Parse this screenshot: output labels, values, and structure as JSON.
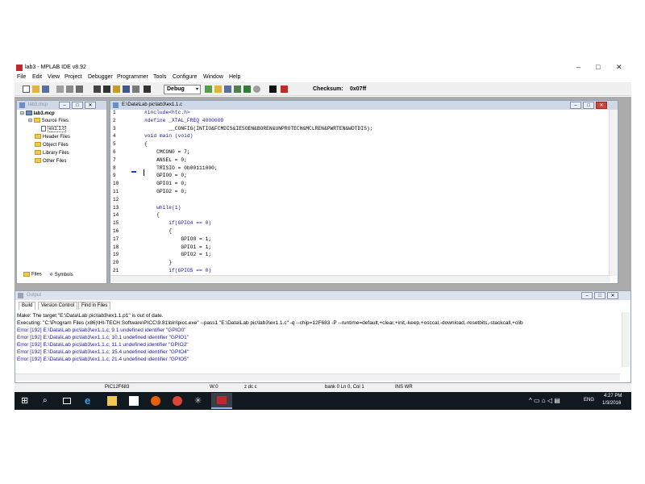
{
  "window": {
    "title": "lab3 - MPLAB IDE v8.92",
    "controls": [
      "–",
      "□",
      "✕"
    ]
  },
  "menu": [
    "File",
    "Edit",
    "View",
    "Project",
    "Debugger",
    "Programmer",
    "Tools",
    "Configure",
    "Window",
    "Help"
  ],
  "toolbar": {
    "config_select": "Debug",
    "checksum_label": "Checksum:",
    "checksum_value": "0x07ff"
  },
  "project_window": {
    "title": "lab3.mcp",
    "tree": [
      {
        "label": "lab3.mcp",
        "bold": true,
        "kind": "project"
      },
      {
        "label": "Source Files",
        "kind": "folder"
      },
      {
        "label": "ex1.1.c",
        "kind": "file"
      },
      {
        "label": "Header Files",
        "kind": "folder"
      },
      {
        "label": "Object Files",
        "kind": "folder"
      },
      {
        "label": "Library Files",
        "kind": "folder"
      },
      {
        "label": "Other Files",
        "kind": "folder"
      }
    ],
    "tabs": [
      "Files",
      "Symbols"
    ]
  },
  "editor": {
    "title": "E:\\Data\\Lab pic\\lab3\\ex1.1.c",
    "line_numbers": [
      "1",
      "2",
      "3",
      "4",
      "5",
      "6",
      "7",
      "8",
      "9",
      "10",
      "11",
      "12",
      "13",
      "14",
      "15",
      "16",
      "17",
      "18",
      "19",
      "20",
      "21"
    ],
    "lines": [
      "#include<htc.h>",
      "#define _XTAL_FREQ 4000000",
      "        __CONFIG(INTIO&FCMDIS&IESOEN&BOREN&UNPROTECH&MCLREN&PWRTEN&WDTDIS);",
      "void main (void)",
      "{",
      "    CMCON0 = 7;",
      "    ANSEL = 0;",
      "    TRISIO = 0b00111000;",
      "    GPIO0 = 0;",
      "    GPIO1 = 0;",
      "    GPIO2 = 0;",
      "",
      "    while(1)",
      "    {",
      "        if(GPIO4 == 0)",
      "        {",
      "            GPIO0 = 1;",
      "            GPIO1 = 1;",
      "            GPIO2 = 1;",
      "        }",
      "        if(GPIO5 == 0)"
    ]
  },
  "output_window": {
    "title": "Output",
    "tabs": [
      "Build",
      "Version Control",
      "Find in Files"
    ],
    "lines": [
      {
        "text": "Make: The target \"E:\\Data\\Lab pic\\lab3\\ex1.1.p1\" is out of date.",
        "error": false
      },
      {
        "text": "Executing: \"C:\\Program Files (x86)\\HI-TECH Software\\PICC\\9.81\\bin\\picc.exe\" --pass1 \"E:\\Data\\Lab pic\\lab3\\ex1.1.c\" -q --chip=12F683 -P --runtime=default,+clear,+init,-keep,+osccal,-download,-resetbits,-stackcall,+clib",
        "error": false
      },
      {
        "text": "Error   [192] E:\\Data\\Lab pic\\lab3\\ex1.1.c; 9.1 undefined identifier \"GPIO0\"",
        "error": true
      },
      {
        "text": "Error   [192] E:\\Data\\Lab pic\\lab3\\ex1.1.c; 10.1 undefined identifier \"GPIO1\"",
        "error": true
      },
      {
        "text": "Error   [192] E:\\Data\\Lab pic\\lab3\\ex1.1.c; 11.1 undefined identifier \"GPIO2\"",
        "error": true
      },
      {
        "text": "Error   [192] E:\\Data\\Lab pic\\lab3\\ex1.1.c; 15.4 undefined identifier \"GPIO4\"",
        "error": true
      },
      {
        "text": "Error   [192] E:\\Data\\Lab pic\\lab3\\ex1.1.c; 21.4 undefined identifier \"GPIO5\"",
        "error": true
      }
    ]
  },
  "statusbar": {
    "device": "PIC12F683",
    "w": "W:0",
    "flags": "z dc c",
    "position": "bank 0   Ln 0, Col 1",
    "mode": "INS   WR"
  },
  "taskbar": {
    "tray_lang": "ENG",
    "time": "4:27 PM",
    "date": "1/3/2016"
  },
  "colors": {
    "error_text": "#1a1aa6",
    "mdi_title": "#cfd8e6",
    "taskbar": "#101820",
    "app_icon": "#c0282d"
  }
}
